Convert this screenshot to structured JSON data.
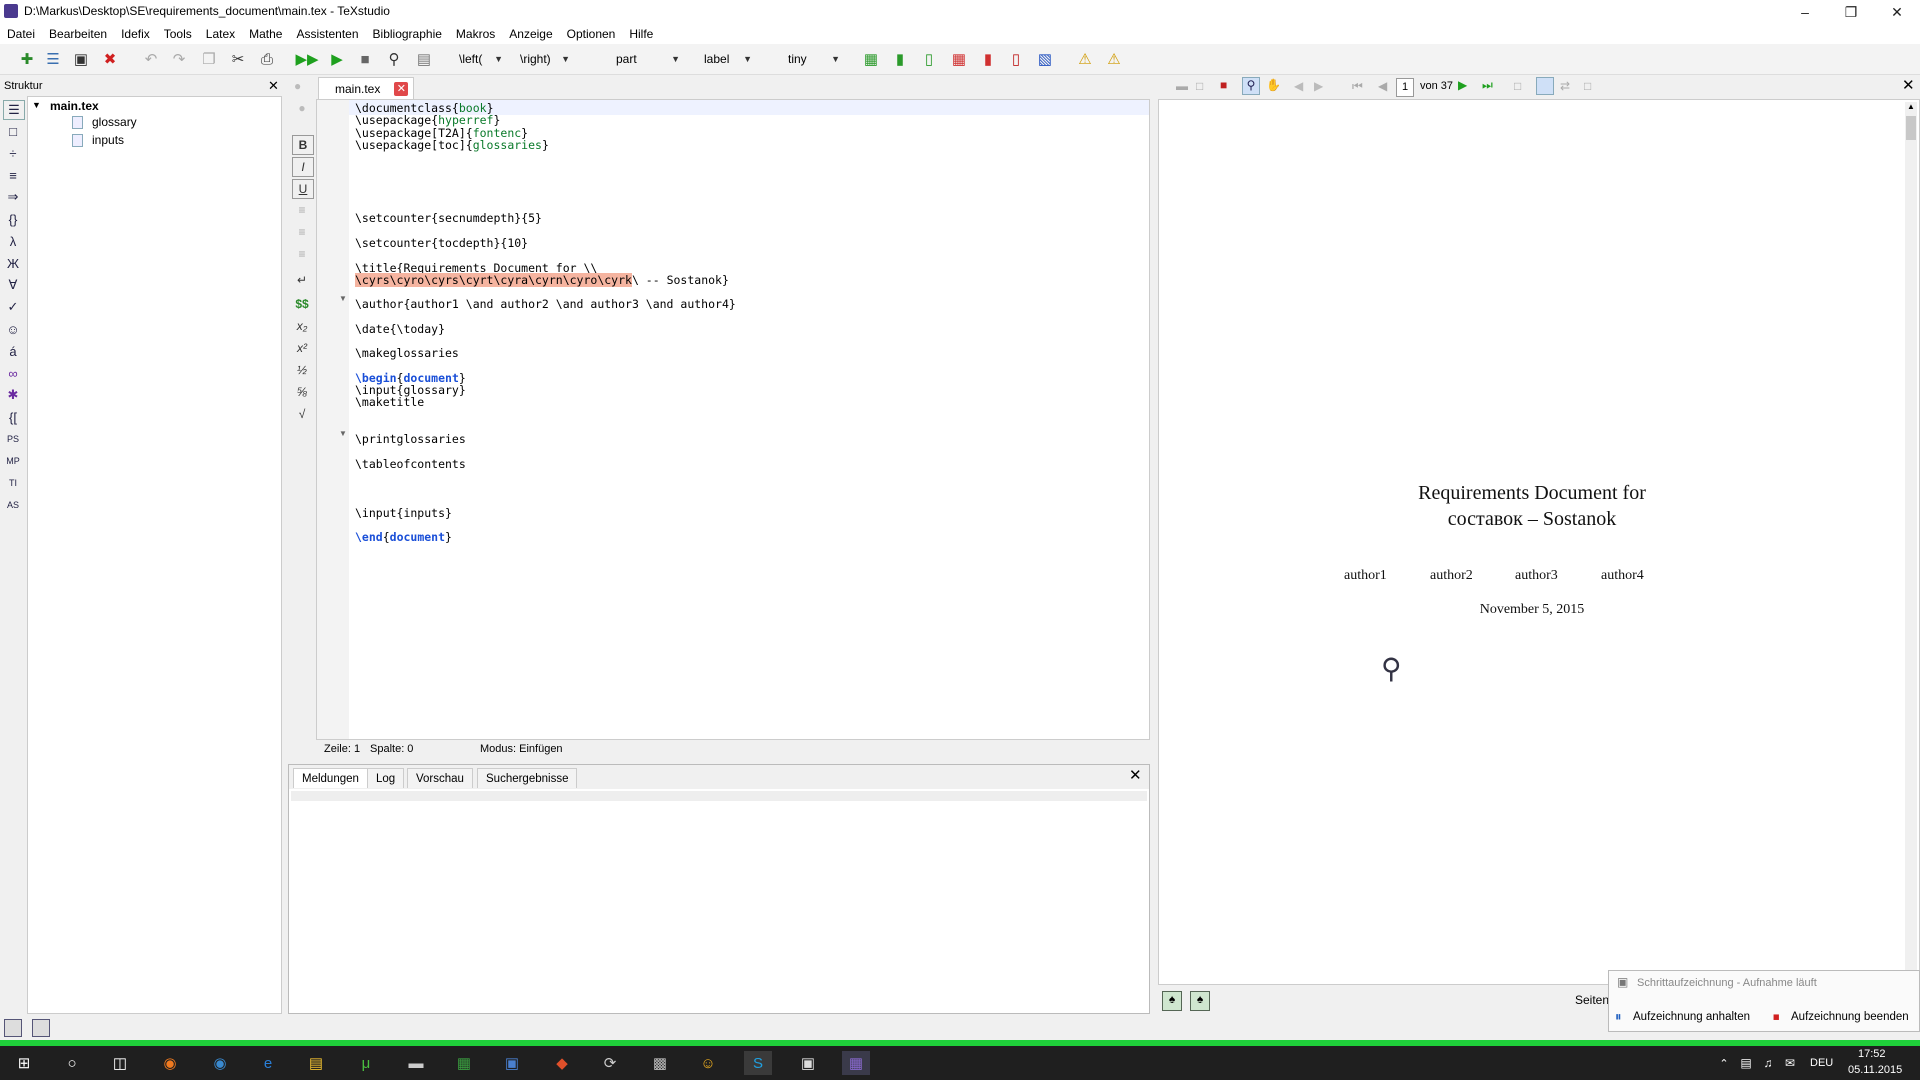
{
  "window": {
    "title": "D:\\Markus\\Desktop\\SE\\requirements_document\\main.tex - TeXstudio"
  },
  "menu": [
    "Datei",
    "Bearbeiten",
    "Idefix",
    "Tools",
    "Latex",
    "Mathe",
    "Assistenten",
    "Bibliographie",
    "Makros",
    "Anzeige",
    "Optionen",
    "Hilfe"
  ],
  "toolbar": {
    "left_delim": "\\left(",
    "right_delim": "\\right)",
    "sectioning": "part",
    "reference": "label",
    "size": "tiny"
  },
  "structure": {
    "title": "Struktur",
    "root": "main.tex",
    "children": [
      "glossary",
      "inputs"
    ]
  },
  "editor": {
    "tab": "main.tex",
    "lines": [
      {
        "y": 0,
        "html": "\\documentclass{<g>book</g>}"
      },
      {
        "y": 1,
        "html": "\\usepackage{<g>hyperref</g>}"
      },
      {
        "y": 2,
        "html": "\\usepackage[T2A]{<g>fontenc</g>}"
      },
      {
        "y": 3,
        "html": "\\usepackage[toc]{<g>glossaries</g>}"
      },
      {
        "y": 9,
        "html": "\\setcounter{secnumdepth}{5}"
      },
      {
        "y": 11,
        "html": "\\setcounter{tocdepth}{10}"
      },
      {
        "y": 13,
        "html": "\\title{Requirements Document for \\\\"
      },
      {
        "y": 14,
        "html": "<h>\\cyrs\\cyro\\cyrs\\cyrt\\cyra\\cyrn\\cyro\\cyrk</h>\\ -- Sostanok}"
      },
      {
        "y": 16,
        "html": "\\author{author1 \\and author2 \\and author3 \\and author4}"
      },
      {
        "y": 18,
        "html": "\\date{\\today}"
      },
      {
        "y": 20,
        "html": "\\makeglossaries"
      },
      {
        "y": 22,
        "html": "<k>\\begin</k>{<k>document</k>}"
      },
      {
        "y": 23,
        "html": "\\input{glossary}"
      },
      {
        "y": 24,
        "html": "\\maketitle"
      },
      {
        "y": 27,
        "html": "\\printglossaries"
      },
      {
        "y": 29,
        "html": "\\tableofcontents"
      },
      {
        "y": 33,
        "html": "\\input{inputs}"
      },
      {
        "y": 35,
        "html": "<k>\\end</k>{<k>document</k>}"
      }
    ]
  },
  "status": {
    "line": "Zeile: 1",
    "col": "Spalte: 0",
    "mode": "Modus: Einfügen"
  },
  "messages": {
    "tabs": [
      "Meldungen",
      "Log",
      "Vorschau",
      "Suchergebnisse"
    ]
  },
  "pdf": {
    "page": "1",
    "of": "von 37",
    "title1": "Requirements Document for",
    "title2": "составок – Sostanok",
    "authors": [
      "author1",
      "author2",
      "author3",
      "author4"
    ],
    "date": "November 5, 2015",
    "pages_label": "Seiten"
  },
  "recording": {
    "title": "Schrittaufzeichnung - Aufnahme läuft",
    "pause": "Aufzeichnung anhalten",
    "stop": "Aufzeichnung beenden"
  },
  "taskbar": {
    "lang": "DEU",
    "time": "17:52",
    "date": "05.11.2015"
  },
  "colors": {
    "green_bar": "#1fcf3a",
    "highlight": "#f5b4a0",
    "keyword": "#1a4fd8",
    "argument": "#0a7a2a"
  }
}
